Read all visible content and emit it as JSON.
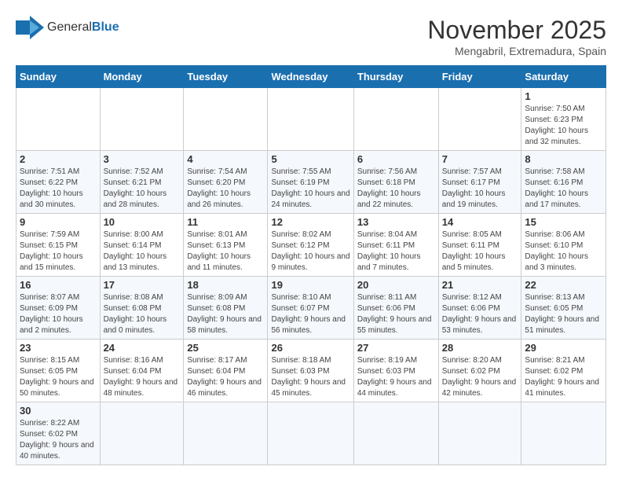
{
  "logo": {
    "text_general": "General",
    "text_blue": "Blue"
  },
  "title": "November 2025",
  "location": "Mengabril, Extremadura, Spain",
  "days_of_week": [
    "Sunday",
    "Monday",
    "Tuesday",
    "Wednesday",
    "Thursday",
    "Friday",
    "Saturday"
  ],
  "weeks": [
    [
      {
        "day": "",
        "info": ""
      },
      {
        "day": "",
        "info": ""
      },
      {
        "day": "",
        "info": ""
      },
      {
        "day": "",
        "info": ""
      },
      {
        "day": "",
        "info": ""
      },
      {
        "day": "",
        "info": ""
      },
      {
        "day": "1",
        "info": "Sunrise: 7:50 AM\nSunset: 6:23 PM\nDaylight: 10 hours and 32 minutes."
      }
    ],
    [
      {
        "day": "2",
        "info": "Sunrise: 7:51 AM\nSunset: 6:22 PM\nDaylight: 10 hours and 30 minutes."
      },
      {
        "day": "3",
        "info": "Sunrise: 7:52 AM\nSunset: 6:21 PM\nDaylight: 10 hours and 28 minutes."
      },
      {
        "day": "4",
        "info": "Sunrise: 7:54 AM\nSunset: 6:20 PM\nDaylight: 10 hours and 26 minutes."
      },
      {
        "day": "5",
        "info": "Sunrise: 7:55 AM\nSunset: 6:19 PM\nDaylight: 10 hours and 24 minutes."
      },
      {
        "day": "6",
        "info": "Sunrise: 7:56 AM\nSunset: 6:18 PM\nDaylight: 10 hours and 22 minutes."
      },
      {
        "day": "7",
        "info": "Sunrise: 7:57 AM\nSunset: 6:17 PM\nDaylight: 10 hours and 19 minutes."
      },
      {
        "day": "8",
        "info": "Sunrise: 7:58 AM\nSunset: 6:16 PM\nDaylight: 10 hours and 17 minutes."
      }
    ],
    [
      {
        "day": "9",
        "info": "Sunrise: 7:59 AM\nSunset: 6:15 PM\nDaylight: 10 hours and 15 minutes."
      },
      {
        "day": "10",
        "info": "Sunrise: 8:00 AM\nSunset: 6:14 PM\nDaylight: 10 hours and 13 minutes."
      },
      {
        "day": "11",
        "info": "Sunrise: 8:01 AM\nSunset: 6:13 PM\nDaylight: 10 hours and 11 minutes."
      },
      {
        "day": "12",
        "info": "Sunrise: 8:02 AM\nSunset: 6:12 PM\nDaylight: 10 hours and 9 minutes."
      },
      {
        "day": "13",
        "info": "Sunrise: 8:04 AM\nSunset: 6:11 PM\nDaylight: 10 hours and 7 minutes."
      },
      {
        "day": "14",
        "info": "Sunrise: 8:05 AM\nSunset: 6:11 PM\nDaylight: 10 hours and 5 minutes."
      },
      {
        "day": "15",
        "info": "Sunrise: 8:06 AM\nSunset: 6:10 PM\nDaylight: 10 hours and 3 minutes."
      }
    ],
    [
      {
        "day": "16",
        "info": "Sunrise: 8:07 AM\nSunset: 6:09 PM\nDaylight: 10 hours and 2 minutes."
      },
      {
        "day": "17",
        "info": "Sunrise: 8:08 AM\nSunset: 6:08 PM\nDaylight: 10 hours and 0 minutes."
      },
      {
        "day": "18",
        "info": "Sunrise: 8:09 AM\nSunset: 6:08 PM\nDaylight: 9 hours and 58 minutes."
      },
      {
        "day": "19",
        "info": "Sunrise: 8:10 AM\nSunset: 6:07 PM\nDaylight: 9 hours and 56 minutes."
      },
      {
        "day": "20",
        "info": "Sunrise: 8:11 AM\nSunset: 6:06 PM\nDaylight: 9 hours and 55 minutes."
      },
      {
        "day": "21",
        "info": "Sunrise: 8:12 AM\nSunset: 6:06 PM\nDaylight: 9 hours and 53 minutes."
      },
      {
        "day": "22",
        "info": "Sunrise: 8:13 AM\nSunset: 6:05 PM\nDaylight: 9 hours and 51 minutes."
      }
    ],
    [
      {
        "day": "23",
        "info": "Sunrise: 8:15 AM\nSunset: 6:05 PM\nDaylight: 9 hours and 50 minutes."
      },
      {
        "day": "24",
        "info": "Sunrise: 8:16 AM\nSunset: 6:04 PM\nDaylight: 9 hours and 48 minutes."
      },
      {
        "day": "25",
        "info": "Sunrise: 8:17 AM\nSunset: 6:04 PM\nDaylight: 9 hours and 46 minutes."
      },
      {
        "day": "26",
        "info": "Sunrise: 8:18 AM\nSunset: 6:03 PM\nDaylight: 9 hours and 45 minutes."
      },
      {
        "day": "27",
        "info": "Sunrise: 8:19 AM\nSunset: 6:03 PM\nDaylight: 9 hours and 44 minutes."
      },
      {
        "day": "28",
        "info": "Sunrise: 8:20 AM\nSunset: 6:02 PM\nDaylight: 9 hours and 42 minutes."
      },
      {
        "day": "29",
        "info": "Sunrise: 8:21 AM\nSunset: 6:02 PM\nDaylight: 9 hours and 41 minutes."
      }
    ],
    [
      {
        "day": "30",
        "info": "Sunrise: 8:22 AM\nSunset: 6:02 PM\nDaylight: 9 hours and 40 minutes."
      },
      {
        "day": "",
        "info": ""
      },
      {
        "day": "",
        "info": ""
      },
      {
        "day": "",
        "info": ""
      },
      {
        "day": "",
        "info": ""
      },
      {
        "day": "",
        "info": ""
      },
      {
        "day": "",
        "info": ""
      }
    ]
  ]
}
